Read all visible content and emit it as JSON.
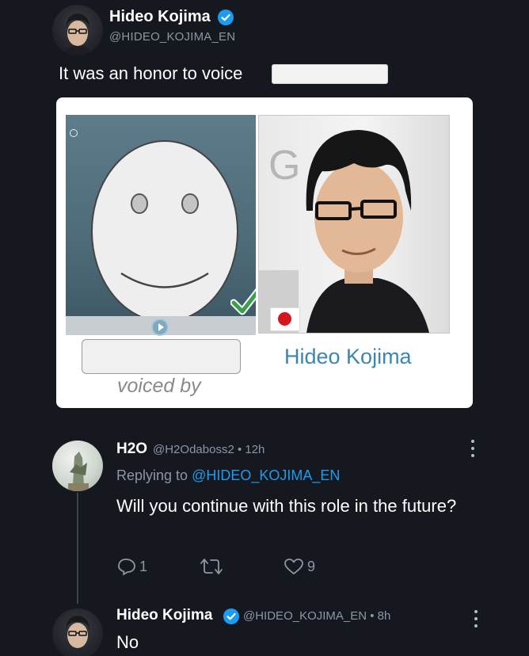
{
  "tweet": {
    "author_name": "Hideo Kojima",
    "author_handle": "@HIDEO_KOJIMA_EN",
    "text": "It was an honor to voice",
    "verified": true
  },
  "card": {
    "right_name": "Hideo Kojima",
    "caption": "voiced by",
    "check_color": "#3aa04a",
    "name_color": "#3b86b0",
    "photo_sign_text": "G"
  },
  "reply": {
    "author_name": "H2O",
    "meta": "@H2Odaboss2 • 12h",
    "replying_prefix": "Replying to",
    "replying_mention": "@HIDEO_KOJIMA_EN",
    "text": "Will you continue with this role in the future?",
    "comment_count": "1",
    "retweet_count": "",
    "like_count": "9"
  },
  "second_reply": {
    "author_name": "Hideo Kojima",
    "meta": "@HIDEO_KOJIMA_EN • 8h",
    "text": "No",
    "verified": true
  },
  "colors": {
    "background": "#15181f",
    "link": "#1d9bf0",
    "muted": "#8b97a4",
    "verified": "#1d9bf0"
  },
  "icons": [
    "verified-badge-icon",
    "more-options-icon",
    "reply-icon",
    "retweet-icon",
    "like-icon",
    "play-icon",
    "checkmark-icon",
    "japan-flag-icon"
  ]
}
